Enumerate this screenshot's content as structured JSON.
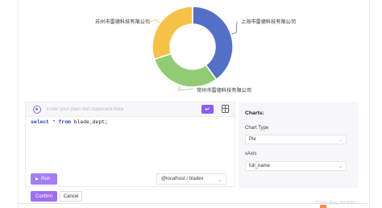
{
  "chart_data": {
    "type": "pie",
    "variant": "donut",
    "series": [
      {
        "name": "苏州市雷德科技有限公司",
        "value": 30,
        "color": "#f6c24a"
      },
      {
        "name": "上海市雷德科技有限公司",
        "value": 40,
        "color": "#5470c6"
      },
      {
        "name": "常州市雷德科技有限公司",
        "value": 30,
        "color": "#91cc75"
      }
    ]
  },
  "editor": {
    "ask_placeholder": "Enter your plain text statement here",
    "enter_symbol": "↵",
    "sql_keyword_select": "select",
    "sql_star": " * ",
    "sql_keyword_from": "from",
    "sql_table": " blade_dept;",
    "run_label": "Run",
    "connection": "@localhost / bladex",
    "caret": "⌄"
  },
  "charts_panel": {
    "title": "Charts:",
    "chart_type_label": "Chart Type",
    "chart_type_value": "Pie",
    "xaxis_label": "xAxis",
    "xaxis_value": "full_name",
    "caret": "⌄"
  },
  "footer": {
    "confirm_label": "Confirm",
    "cancel_label": "Cancel",
    "watermark": "CSDN @qq_33730251"
  }
}
